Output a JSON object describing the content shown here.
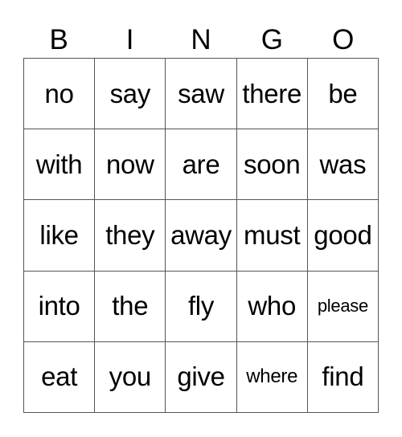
{
  "title_letters": [
    "B",
    "I",
    "N",
    "G",
    "O"
  ],
  "rows": [
    [
      "no",
      "say",
      "saw",
      "there",
      "be"
    ],
    [
      "with",
      "now",
      "are",
      "soon",
      "was"
    ],
    [
      "like",
      "they",
      "away",
      "must",
      "good"
    ],
    [
      "into",
      "the",
      "fly",
      "who",
      "please"
    ],
    [
      "eat",
      "you",
      "give",
      "where",
      "find"
    ]
  ]
}
